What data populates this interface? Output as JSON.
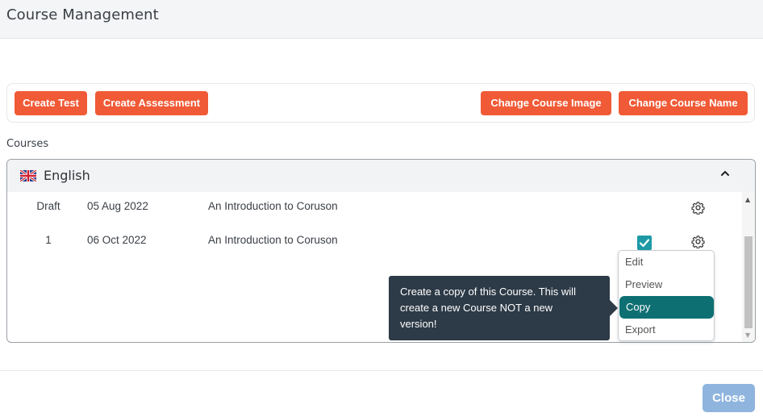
{
  "header": {
    "title": "Course Management"
  },
  "toolbar": {
    "create_test": "Create Test",
    "create_assessment": "Create Assessment",
    "change_image": "Change Course Image",
    "change_name": "Change Course Name"
  },
  "courses": {
    "label": "Courses",
    "language": "English",
    "flag_icon": "uk-flag-icon",
    "rows": [
      {
        "version": "Draft",
        "date": "05 Aug 2022",
        "name": "An Introduction to Coruson"
      },
      {
        "version": "1",
        "date": "06 Oct 2022",
        "name": "An Introduction to Coruson"
      }
    ]
  },
  "menu": {
    "items": [
      {
        "label": "Edit"
      },
      {
        "label": "Preview"
      },
      {
        "label": "Copy"
      },
      {
        "label": "Export"
      }
    ]
  },
  "tooltip": {
    "line1": "Create a copy of this Course. This will",
    "line2": "create a new Course NOT a new",
    "line3": "version!"
  },
  "footer": {
    "close": "Close"
  },
  "colors": {
    "accent": "#f05a36",
    "teal": "#0e6f72",
    "close": "#8fb5de",
    "tooltip": "#2d3a47"
  }
}
